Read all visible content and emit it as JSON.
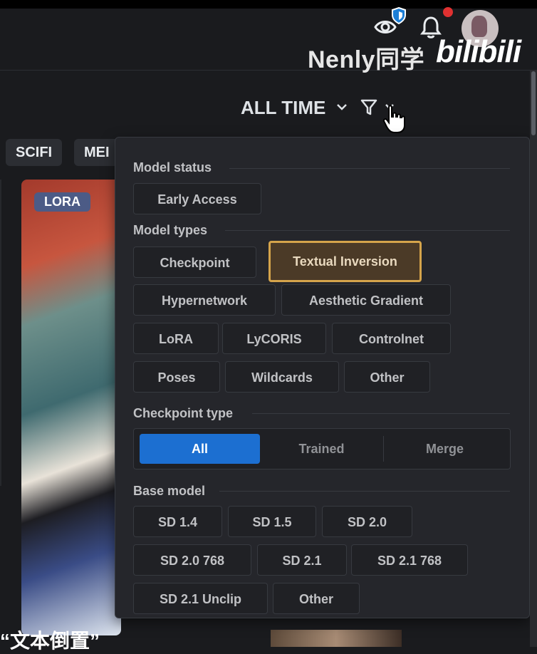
{
  "watermark": {
    "name": "Nenly同学",
    "logo": "bilibili"
  },
  "sort": {
    "period_label": "ALL TIME"
  },
  "tags": [
    "SCIFI",
    "MEI"
  ],
  "card": {
    "badge": "LORA"
  },
  "caption": "“文本倒置”",
  "filters": {
    "model_status": {
      "title": "Model status",
      "options": [
        "Early Access"
      ]
    },
    "model_types": {
      "title": "Model types",
      "options": [
        "Checkpoint",
        "Textual Inversion",
        "Hypernetwork",
        "Aesthetic Gradient",
        "LoRA",
        "LyCORIS",
        "Controlnet",
        "Poses",
        "Wildcards",
        "Other"
      ],
      "selected": "Textual Inversion"
    },
    "checkpoint_type": {
      "title": "Checkpoint type",
      "options": [
        "All",
        "Trained",
        "Merge"
      ],
      "selected": "All"
    },
    "base_model": {
      "title": "Base model",
      "options": [
        "SD 1.4",
        "SD 1.5",
        "SD 2.0",
        "SD 2.0 768",
        "SD 2.1",
        "SD 2.1 768",
        "SD 2.1 Unclip",
        "Other"
      ]
    }
  },
  "colors": {
    "accent_blue": "#1c6fd1",
    "selected_border": "#d5a44b",
    "notification_dot": "#e03131"
  },
  "icons": [
    "eye-icon",
    "shield-icon",
    "bell-icon",
    "chevron-down-icon",
    "filter-icon",
    "hand-cursor-icon"
  ]
}
